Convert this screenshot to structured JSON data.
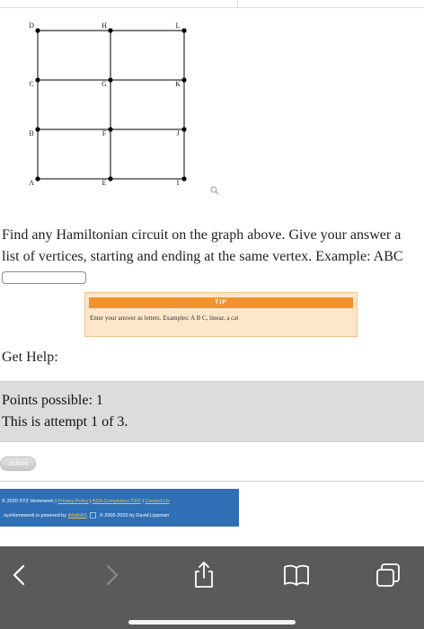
{
  "graph": {
    "vertices": [
      "A",
      "B",
      "C",
      "D",
      "E",
      "F",
      "G",
      "H",
      "I",
      "J",
      "K",
      "L"
    ],
    "edges": [
      [
        "A",
        "E"
      ],
      [
        "E",
        "I"
      ],
      [
        "B",
        "F"
      ],
      [
        "F",
        "J"
      ],
      [
        "C",
        "G"
      ],
      [
        "G",
        "K"
      ],
      [
        "D",
        "H"
      ],
      [
        "H",
        "L"
      ],
      [
        "A",
        "B"
      ],
      [
        "B",
        "C"
      ],
      [
        "C",
        "D"
      ],
      [
        "E",
        "F"
      ],
      [
        "F",
        "G"
      ],
      [
        "G",
        "H"
      ],
      [
        "I",
        "J"
      ],
      [
        "J",
        "K"
      ],
      [
        "K",
        "L"
      ]
    ]
  },
  "question": {
    "line1": "Find any Hamiltonian circuit on the graph above. Give your answer a",
    "line2": "list of vertices, starting and ending at the same vertex. Example: ABC"
  },
  "answer": {
    "value": "",
    "placeholder": ""
  },
  "tip": {
    "title": "TIP",
    "text": "Enter your answer as letters. Examples: A B C, linear, a cat"
  },
  "help": {
    "label": "Get Help:"
  },
  "points": {
    "possible": "Points possible: 1",
    "attempt": "This is attempt 1 of 3."
  },
  "submit": {
    "label": "Submit"
  },
  "footer": {
    "copyright": "© 2020 XYZ Homework",
    "privacy": "Privacy Policy",
    "ada": "ADA Compliance PDF",
    "contact": "Contact Us",
    "powered": "xyzHomework is powered by",
    "imathas": "IMathAS",
    "credit": "© 2006-2020 by David Lippman"
  },
  "toolbar": {
    "icons": [
      "back-icon",
      "forward-icon",
      "share-icon",
      "bookmarks-icon",
      "tabs-icon"
    ]
  },
  "colors": {
    "tip_header": "#f0932f",
    "tip_bg": "#fde6c9",
    "footer_bg": "#2f6fb5",
    "toolbar_bg": "#5a5a5c"
  }
}
